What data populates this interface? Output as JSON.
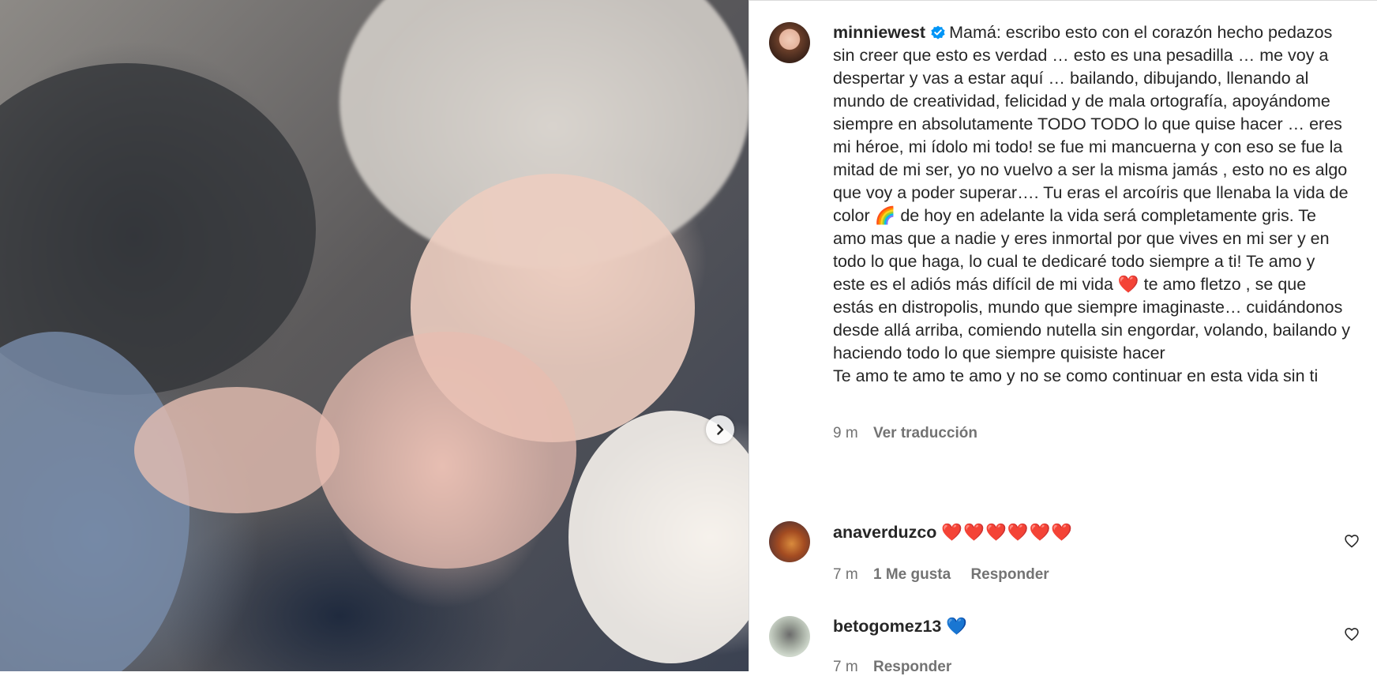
{
  "post": {
    "username": "minniewest",
    "verified": true,
    "caption_intro": "Mamá: escribo esto con el corazón hecho pedazos sin creer que esto es verdad … esto es una pesadilla … me voy a despertar y vas a estar aquí … bailando, dibujando, llenando al mundo de creatividad, felicidad y de mala ortografía, apoyándome siempre en absolutamente TODO TODO lo que quise hacer … eres mi héroe, mi ídolo mi todo! se fue mi mancuerna y con eso se fue la mitad de mi ser, yo no vuelvo a ser la misma jamás , esto no es algo que voy a poder superar…. Tu eras el arcoíris que llenaba la vida de color 🌈 de hoy en adelante la vida será completamente gris. Te amo mas que a nadie y eres inmortal por que vives en mi ser y en todo lo que haga, lo cual te dedicaré todo siempre a ti! Te amo y este es el adiós más difícil de mi vida ❤️ te amo fletzo , se que estás en distropolis, mundo que siempre imaginaste… cuidándonos desde allá arriba, comiendo nutella sin engordar, volando, bailando y haciendo todo lo que siempre quisiste hacer",
    "caption_outro": "Te amo te amo te amo y no se como continuar en esta vida sin ti",
    "time": "9 m",
    "translate_label": "Ver traducción"
  },
  "comments": [
    {
      "username": "anaverduzco",
      "text": "❤️❤️❤️❤️❤️❤️",
      "time": "7 m",
      "likes_label": "1 Me gusta",
      "reply_label": "Responder"
    },
    {
      "username": "betogomez13",
      "text": "💙",
      "time": "7 m",
      "reply_label": "Responder"
    }
  ],
  "icons": {
    "verified": "verified-badge-icon",
    "next": "chevron-right-icon",
    "like": "heart-outline-icon"
  },
  "colors": {
    "verified_blue": "#0095f6",
    "muted": "#737373",
    "text": "#262626"
  }
}
